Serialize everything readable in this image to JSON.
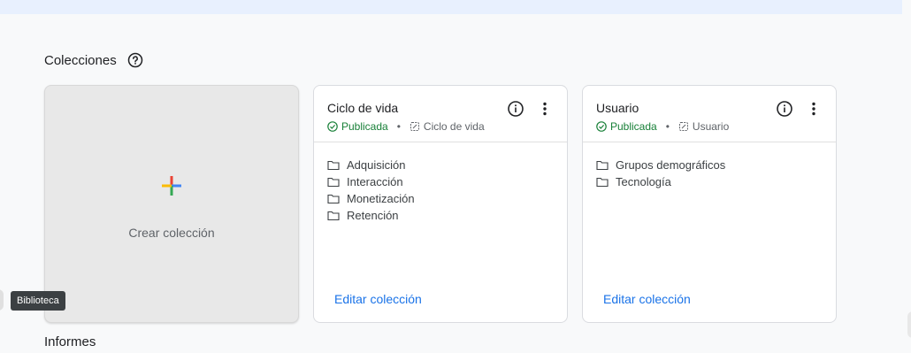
{
  "collections": {
    "title": "Colecciones",
    "help_icon": "help-circle-icon"
  },
  "create_card": {
    "label": "Crear colección",
    "icon": "plus-icon",
    "colors": [
      "#ea4335",
      "#fbbc04",
      "#34a853",
      "#4285f4"
    ]
  },
  "cards": [
    {
      "title": "Ciclo de vida",
      "status": "Publicada",
      "template": "Ciclo de vida",
      "items": [
        "Adquisición",
        "Interacción",
        "Monetización",
        "Retención"
      ],
      "edit_label": "Editar colección"
    },
    {
      "title": "Usuario",
      "status": "Publicada",
      "template": "Usuario",
      "items": [
        "Grupos demográficos",
        "Tecnología"
      ],
      "edit_label": "Editar colección"
    }
  ],
  "tooltip": {
    "text": "Biblioteca"
  },
  "reports": {
    "title": "Informes"
  },
  "colors": {
    "accent": "#1a73e8",
    "published": "#188038",
    "banner": "#e8f0fe"
  }
}
